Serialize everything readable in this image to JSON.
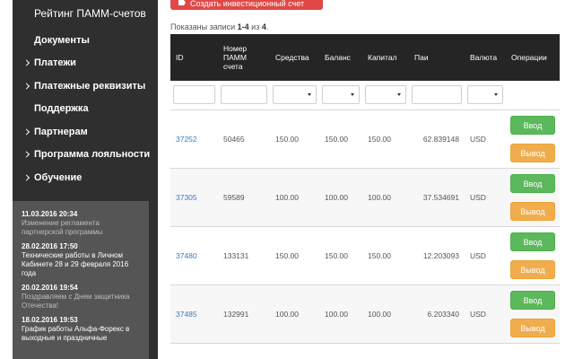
{
  "sidebar": {
    "top_link": "Рейтинг ПАММ-счетов",
    "items": [
      {
        "label": "Документы",
        "chevron": false
      },
      {
        "label": "Платежи",
        "chevron": true
      },
      {
        "label": "Платежные реквизиты",
        "chevron": true
      },
      {
        "label": "Поддержка",
        "chevron": false
      },
      {
        "label": "Партнерам",
        "chevron": true
      },
      {
        "label": "Программа лояльности",
        "chevron": true
      },
      {
        "label": "Обучение",
        "chevron": true
      }
    ],
    "news": [
      {
        "date": "11.03.2016 20:34",
        "text": "Изменение регламента партнерской программы"
      },
      {
        "date": "28.02.2016 17:50",
        "text": "Технические работы в Личном Кабинете 28 и 29 февраля 2016 года"
      },
      {
        "date": "20.02.2016 19:54",
        "text": "Поздравляем с Днем защитника Отечества!"
      },
      {
        "date": "18.02.2016 19:53",
        "text": "График работы Альфа-Форекс в выходные и праздничные"
      }
    ]
  },
  "main": {
    "create_button": "Создать инвестиционный счет",
    "records_prefix": "Показаны записи ",
    "records_range": "1-4",
    "records_middle": " из ",
    "records_total": "4",
    "records_suffix": ".",
    "columns": [
      "ID",
      "Номер ПАММ счета",
      "Средства",
      "Баланс",
      "Капитал",
      "Паи",
      "Валюта",
      "Операции"
    ],
    "deposit_label": "Ввод",
    "withdraw_label": "Вывод",
    "rows": [
      {
        "id": "37252",
        "number": "50465",
        "funds": "150.00",
        "balance": "150.00",
        "capital": "150.00",
        "shares": "62.839148",
        "currency": "USD"
      },
      {
        "id": "37305",
        "number": "59589",
        "funds": "100.00",
        "balance": "100.00",
        "capital": "100.00",
        "shares": "37.534691",
        "currency": "USD"
      },
      {
        "id": "37480",
        "number": "133131",
        "funds": "150.00",
        "balance": "150.00",
        "capital": "150.00",
        "shares": "12.203093",
        "currency": "USD"
      },
      {
        "id": "37485",
        "number": "132991",
        "funds": "100.00",
        "balance": "100.00",
        "capital": "100.00",
        "shares": "6.203340",
        "currency": "USD"
      }
    ]
  },
  "colors": {
    "sidebar_bg": "#2f2f2f",
    "news_bg": "#555555",
    "header_bg": "#252525",
    "create_btn": "#e04848",
    "deposit_btn": "#5cb85c",
    "withdraw_btn": "#f0ad4e",
    "link": "#3a79c4"
  }
}
